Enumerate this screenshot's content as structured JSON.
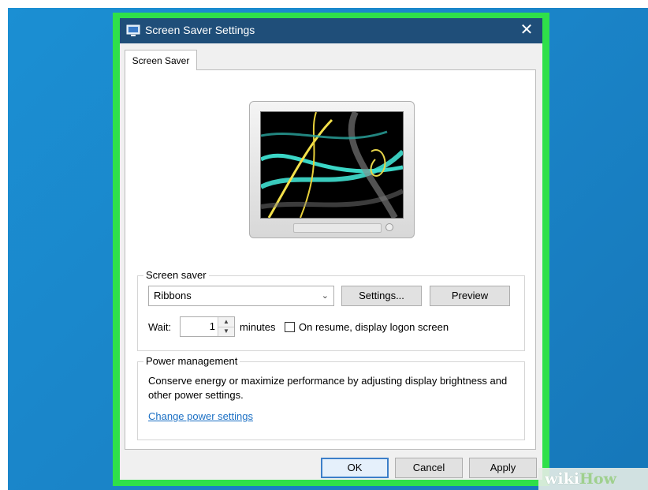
{
  "window": {
    "title": "Screen Saver Settings",
    "close_glyph": "✕"
  },
  "tabs": [
    {
      "label": "Screen Saver"
    }
  ],
  "screen_saver": {
    "group_label": "Screen saver",
    "selected": "Ribbons",
    "settings_button": "Settings...",
    "preview_button": "Preview",
    "wait_label": "Wait:",
    "wait_value": "1",
    "minutes_label": "minutes",
    "resume_label": "On resume, display logon screen",
    "resume_checked": false
  },
  "power": {
    "group_label": "Power management",
    "description": "Conserve energy or maximize performance by adjusting display brightness and other power settings.",
    "link": "Change power settings"
  },
  "footer": {
    "ok": "OK",
    "cancel": "Cancel",
    "apply": "Apply"
  },
  "watermark": {
    "wiki": "wiki",
    "how": "How"
  },
  "colors": {
    "highlight_frame": "#2fe04a",
    "titlebar": "#1f4e79",
    "desktop": "#1a84c8",
    "link": "#1a6fc4"
  },
  "icons": [
    "screen-saver-icon",
    "close-icon",
    "chevron-down-icon",
    "spin-up-icon",
    "spin-down-icon"
  ]
}
